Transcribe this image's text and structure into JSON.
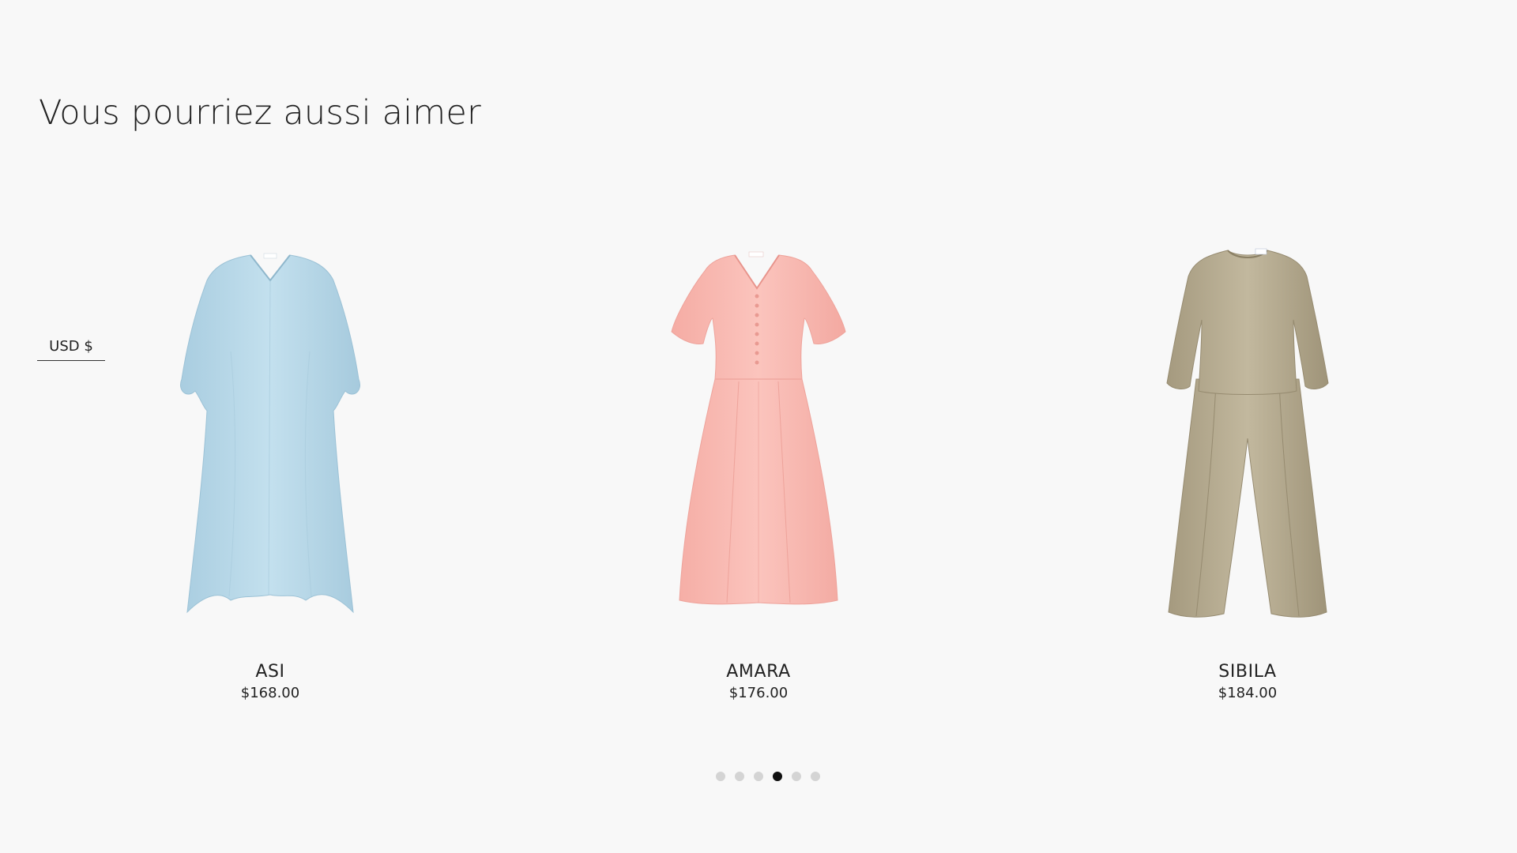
{
  "section": {
    "title": "Vous pourriez aussi aimer"
  },
  "currency": {
    "label": "USD $"
  },
  "products": [
    {
      "name": "ASI",
      "price": "$168.00",
      "color": "#b9d8e8"
    },
    {
      "name": "AMARA",
      "price": "$176.00",
      "color": "#f7b8b1"
    },
    {
      "name": "SIBILA",
      "price": "$184.00",
      "color": "#b3a88e"
    }
  ],
  "carousel": {
    "dot_count": 6,
    "active_index": 3
  }
}
